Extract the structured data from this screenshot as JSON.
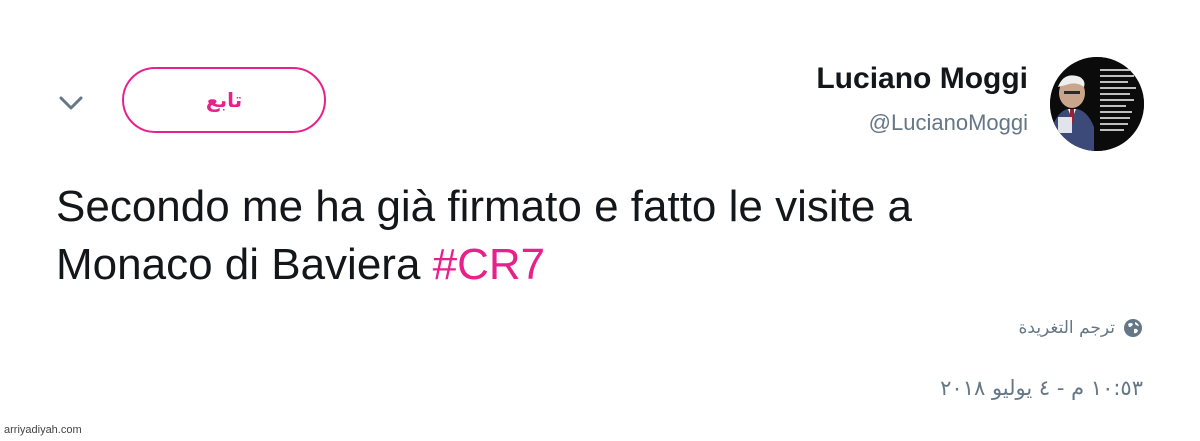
{
  "user": {
    "name": "Luciano Moggi",
    "handle": "@LucianoMoggi"
  },
  "follow_button": {
    "label": "تابع"
  },
  "tweet": {
    "line1": "Secondo me ha già firmato e fatto le visite a",
    "line2_text": "Monaco di Baviera ",
    "hashtag": "#CR7"
  },
  "translate": {
    "label": "ترجم التغريدة"
  },
  "timestamp": "١٠:٥٣ م - ٤ يوليو ٢٠١٨",
  "watermark": "arriyadiyah.com",
  "colors": {
    "accent": "#e8218a",
    "text": "#14171a",
    "muted": "#657786"
  },
  "icons": {
    "more": "chevron-down-icon",
    "translate": "globe-icon"
  }
}
